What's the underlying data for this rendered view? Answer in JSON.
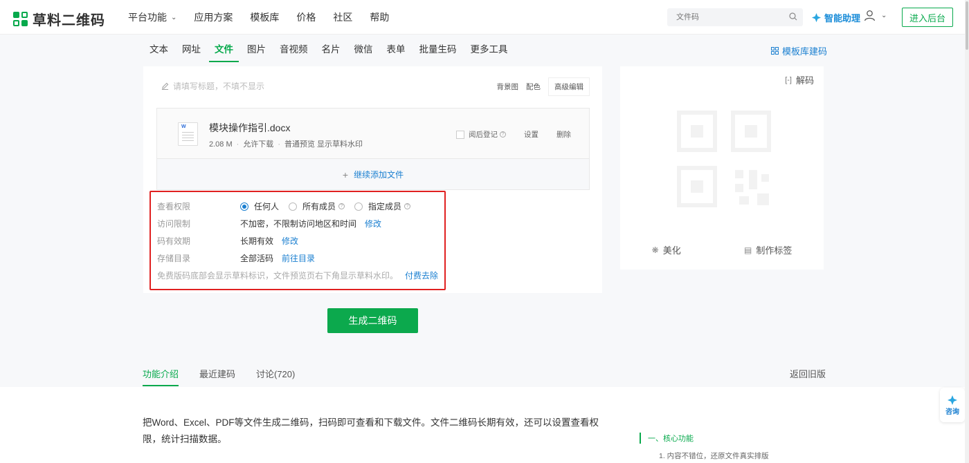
{
  "header": {
    "logo_text": "草料二维码",
    "nav": [
      "平台功能",
      "应用方案",
      "模板库",
      "价格",
      "社区",
      "帮助"
    ],
    "search_placeholder": "文件码",
    "assistant_label": "智能助理",
    "enter_label": "进入后台"
  },
  "type_tabs": {
    "items": [
      "文本",
      "网址",
      "文件",
      "图片",
      "音视频",
      "名片",
      "微信",
      "表单",
      "批量生码",
      "更多工具"
    ],
    "active": "文件",
    "template_link": "模板库建码"
  },
  "editor": {
    "title_placeholder": "请填写标题，不填不显示",
    "tools": [
      "背景图",
      "配色"
    ],
    "advanced_label": "高级编辑",
    "file": {
      "icon_letter": "W",
      "name": "模块操作指引.docx",
      "size": "2.08 M",
      "download": "允许下载",
      "preview": "普通预览 显示草料水印",
      "register_label": "阅后登记",
      "settings_label": "设置",
      "delete_label": "删除"
    },
    "add_file_label": "继续添加文件"
  },
  "settings": {
    "view_permission": {
      "label": "查看权限",
      "options": [
        "任何人",
        "所有成员",
        "指定成员"
      ],
      "selected": "任何人"
    },
    "access_limit": {
      "label": "访问限制",
      "value": "不加密，不限制访问地区和时间",
      "link": "修改"
    },
    "validity": {
      "label": "码有效期",
      "value": "长期有效",
      "link": "修改"
    },
    "storage": {
      "label": "存储目录",
      "value": "全部活码",
      "link": "前往目录"
    },
    "notice": "免费版码底部会显示草料标识，文件预览页右下角显示草料水印。",
    "notice_link": "付费去除"
  },
  "generate_label": "生成二维码",
  "qr_card": {
    "decode_label": "解码",
    "beautify_label": "美化",
    "label_label": "制作标签"
  },
  "bottom_tabs": {
    "items": [
      "功能介绍",
      "最近建码",
      "讨论(720)"
    ],
    "active": "功能介绍",
    "old_version": "返回旧版"
  },
  "intro": {
    "text": "把Word、Excel、PDF等文件生成二维码，扫码即可查看和下载文件。文件二维码长期有效，还可以设置查看权限，统计扫描数据。",
    "toc_head": "一、核心功能",
    "toc_item": "1. 内容不错位，还原文件真实排版"
  },
  "consult_label": "咨询",
  "colors": {
    "brand": "#07a94c",
    "link": "#1a7fd0",
    "alert": "#e02020"
  }
}
